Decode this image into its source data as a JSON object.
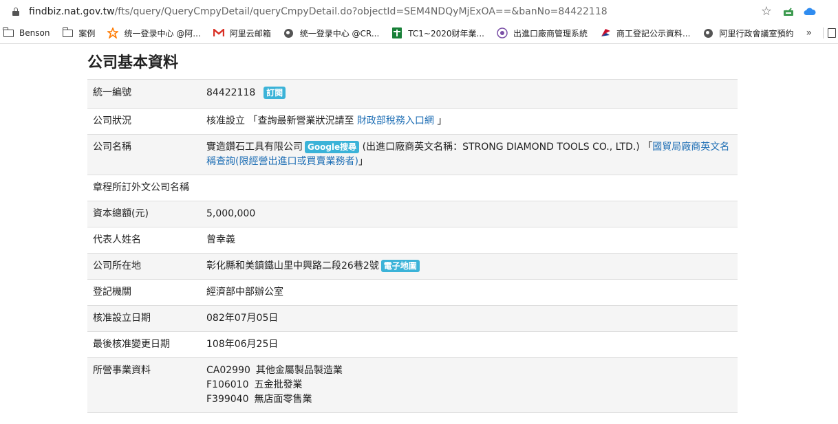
{
  "browser": {
    "url_domain": "findbiz.nat.gov.tw",
    "url_path": "/fts/query/QueryCmpyDetail/queryCmpyDetail.do?objectId=SEM4NDQyMjExOA==&banNo=84422118",
    "bookmarks": [
      {
        "label": "Benson",
        "icon": "folder-icon"
      },
      {
        "label": "案例",
        "icon": "folder-icon"
      },
      {
        "label": "统一登录中心 @阿...",
        "icon": "star-flower-icon",
        "color": "#ff7a00"
      },
      {
        "label": "阿里云邮箱",
        "icon": "gmail-m-icon",
        "color": "#d93025"
      },
      {
        "label": "统一登录中心 @CR...",
        "icon": "globe-icon"
      },
      {
        "label": "TC1~2020财年業...",
        "icon": "sheet-plus-icon",
        "color": "#188038"
      },
      {
        "label": "出進口廠商管理系統",
        "icon": "seal-icon",
        "color": "#7a4fa6"
      },
      {
        "label": "商工登記公示資料...",
        "icon": "flag-icon",
        "color": "#c8102e"
      },
      {
        "label": "阿里行政會議室預約",
        "icon": "globe-icon"
      }
    ],
    "more_label": "»"
  },
  "page": {
    "title": "公司基本資料",
    "rows": [
      {
        "label": "統一編號",
        "value": "84422118",
        "badge": "訂閱"
      },
      {
        "label": "公司狀況",
        "value_prefix": "核准設立 「查詢最新營業狀況請至 ",
        "link": "財政部稅務入口網",
        "value_suffix": " 」"
      },
      {
        "label": "公司名稱",
        "value_prefix": "實造鑽石工具有限公司",
        "badge": "Google搜尋",
        "value_mid": " (出進口廠商英文名稱：STRONG DIAMOND TOOLS CO., LTD.) 「",
        "link": "國貿局廠商英文名稱查詢(限經營出進口或買賣業務者)",
        "value_suffix": "」"
      },
      {
        "label": "章程所訂外文公司名稱",
        "value": ""
      },
      {
        "label": "資本總額(元)",
        "value": "5,000,000"
      },
      {
        "label": "代表人姓名",
        "value": "曾幸義"
      },
      {
        "label": "公司所在地",
        "value": "彰化縣和美鎮鐵山里中興路二段26巷2號",
        "badge": "電子地圖"
      },
      {
        "label": "登記機關",
        "value": "經濟部中部辦公室"
      },
      {
        "label": "核准設立日期",
        "value": "082年07月05日"
      },
      {
        "label": "最後核准變更日期",
        "value": "108年06月25日"
      },
      {
        "label": "所營事業資料",
        "items": [
          {
            "code": "CA02990",
            "desc": "其他金屬製品製造業"
          },
          {
            "code": "F106010",
            "desc": "五金批發業"
          },
          {
            "code": "F399040",
            "desc": "無店面零售業"
          }
        ]
      }
    ]
  },
  "colors": {
    "badge": "#3bb3d8",
    "link": "#1f6fb5",
    "row_alt": "#f5f5f5"
  }
}
